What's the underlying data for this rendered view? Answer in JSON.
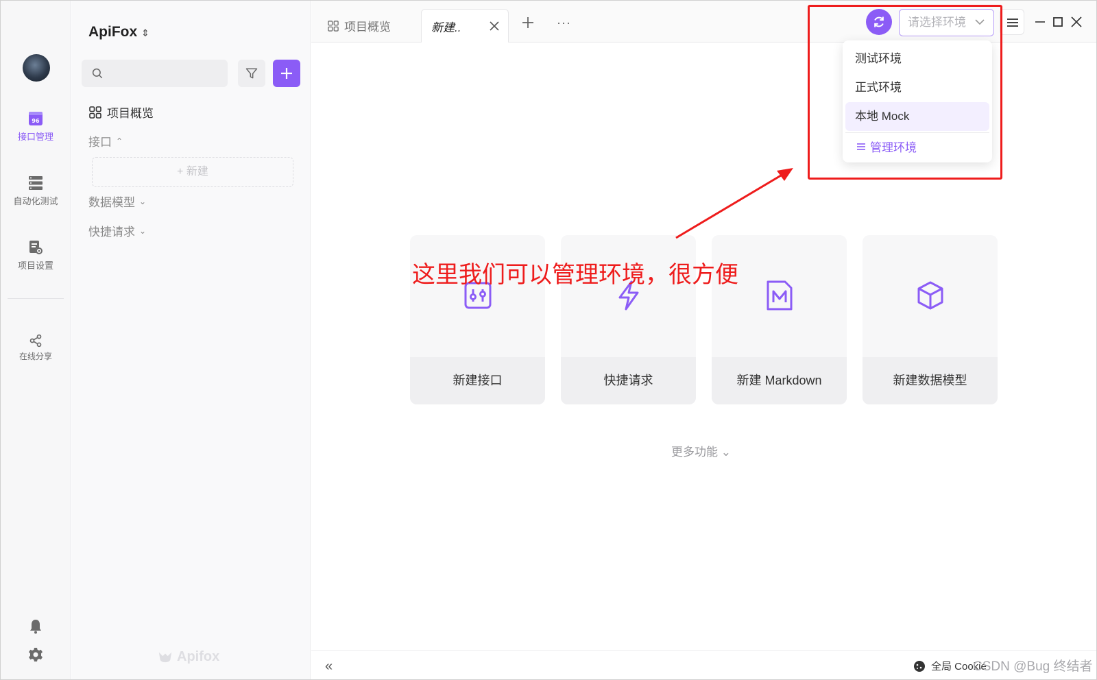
{
  "rail": {
    "items": [
      {
        "label": "接口管理"
      },
      {
        "label": "自动化测试"
      },
      {
        "label": "项目设置"
      },
      {
        "label": "在线分享"
      }
    ]
  },
  "sidebar": {
    "project_title": "ApiFox",
    "search_placeholder": "",
    "overview_label": "项目概览",
    "groups": [
      {
        "label": "接口",
        "chevron": "⌃"
      },
      {
        "label": "数据模型",
        "chevron": "⌄"
      },
      {
        "label": "快捷请求",
        "chevron": "⌄"
      }
    ],
    "new_label": "+ 新建",
    "logo_text": "Apifox"
  },
  "tabs": {
    "overview_label": "项目概览",
    "active_label": "新建..",
    "more_label": "···"
  },
  "env": {
    "placeholder": "请选择环境",
    "options": [
      "测试环境",
      "正式环境",
      "本地 Mock"
    ],
    "manage_label": "管理环境"
  },
  "annotation": {
    "text": "这里我们可以管理环境，很方便"
  },
  "cards": [
    {
      "label": "新建接口",
      "icon": "api-icon"
    },
    {
      "label": "快捷请求",
      "icon": "lightning-icon"
    },
    {
      "label": "新建 Markdown",
      "icon": "markdown-icon"
    },
    {
      "label": "新建数据模型",
      "icon": "cube-icon"
    }
  ],
  "more_functions": "更多功能 ⌄",
  "bottom": {
    "collapse_label": "«",
    "cookie_label": "全局 Cookie",
    "watermark": "CSDN @Bug 终结者"
  },
  "colors": {
    "accent": "#8b5cf6",
    "annotation_red": "#ee1c1c"
  }
}
